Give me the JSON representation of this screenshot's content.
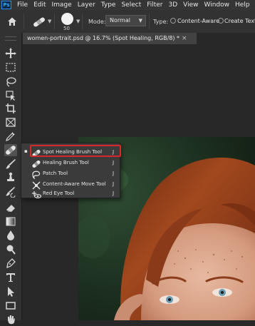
{
  "app": {
    "logo": "Ps"
  },
  "menu": [
    "File",
    "Edit",
    "Image",
    "Layer",
    "Type",
    "Select",
    "Filter",
    "3D",
    "View",
    "Window",
    "Help"
  ],
  "options": {
    "brush_size": "50",
    "mode_label": "Mode:",
    "mode_value": "Normal",
    "type_label": "Type:",
    "type_options": [
      "Content-Aware",
      "Create Texture"
    ]
  },
  "document_tab": {
    "title": "women-portrait.psd @ 16.7% (Spot Healing, RGB/8) *",
    "close": "×"
  },
  "tools": [
    "move-icon",
    "marquee-icon",
    "lasso-icon",
    "object-selection-icon",
    "crop-icon",
    "eyedropper-icon",
    "spot-healing-brush-icon",
    "brush-icon",
    "clone-stamp-icon",
    "history-brush-icon",
    "eraser-icon",
    "gradient-icon",
    "blur-icon",
    "dodge-icon",
    "pen-icon",
    "type-icon",
    "path-selection-icon",
    "rectangle-icon"
  ],
  "flyout": {
    "items": [
      {
        "label": "Spot Healing Brush Tool",
        "shortcut": "J",
        "selected": true,
        "bullet": "▪"
      },
      {
        "label": "Healing Brush Tool",
        "shortcut": "J",
        "selected": false
      },
      {
        "label": "Patch Tool",
        "shortcut": "J",
        "selected": false
      },
      {
        "label": "Content-Aware Move Tool",
        "shortcut": "J",
        "selected": false
      },
      {
        "label": "Red Eye Tool",
        "shortcut": "J",
        "selected": false
      }
    ]
  },
  "colors": {
    "highlight": "#d42a2a",
    "hair": "#8a3a18",
    "skin": "#d9a48a",
    "eyes": "#6a9ab0",
    "foliage": "#1f3a24"
  }
}
